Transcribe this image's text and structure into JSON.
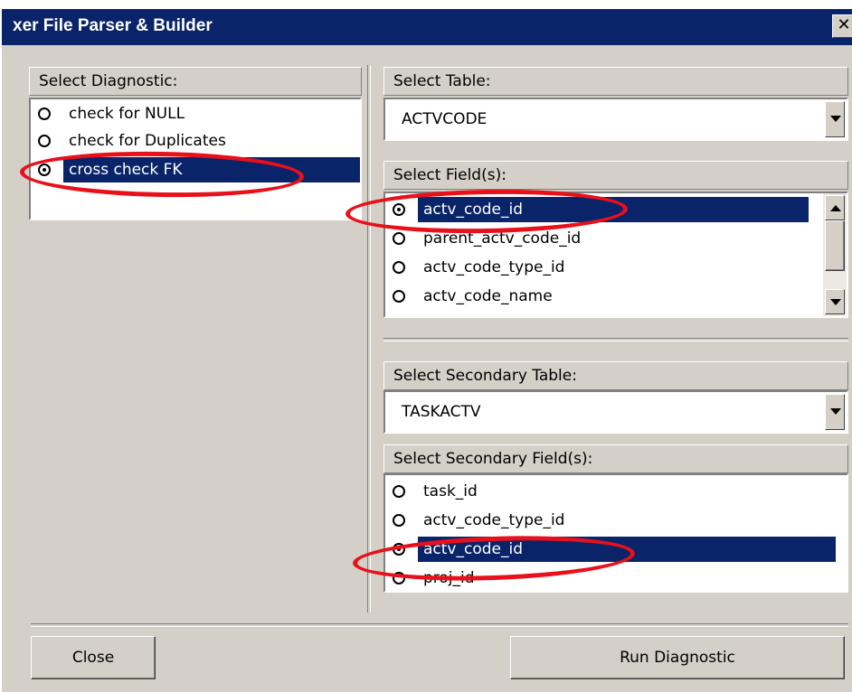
{
  "window": {
    "title": "xer File Parser & Builder",
    "close_glyph": "✕"
  },
  "diagnostic": {
    "header": "Select Diagnostic:",
    "options": [
      {
        "label": "check for NULL",
        "selected": false
      },
      {
        "label": "check for Duplicates",
        "selected": false
      },
      {
        "label": "cross check FK",
        "selected": true
      }
    ]
  },
  "table": {
    "header": "Select Table:",
    "value": "ACTVCODE"
  },
  "fields": {
    "header": "Select Field(s):",
    "options": [
      {
        "label": "actv_code_id",
        "selected": true
      },
      {
        "label": "parent_actv_code_id",
        "selected": false
      },
      {
        "label": "actv_code_type_id",
        "selected": false
      },
      {
        "label": "actv_code_name",
        "selected": false
      }
    ]
  },
  "secondary_table": {
    "header": "Select Secondary Table:",
    "value": "TASKACTV"
  },
  "secondary_fields": {
    "header": "Select Secondary Field(s):",
    "options": [
      {
        "label": "task_id",
        "selected": false
      },
      {
        "label": "actv_code_type_id",
        "selected": false
      },
      {
        "label": "actv_code_id",
        "selected": true
      },
      {
        "label": "proj_id",
        "selected": false
      }
    ]
  },
  "buttons": {
    "close": "Close",
    "run": "Run Diagnostic"
  },
  "colors": {
    "selection": "#0a246a",
    "face": "#d4d0c8",
    "annotation": "#e8101a"
  }
}
